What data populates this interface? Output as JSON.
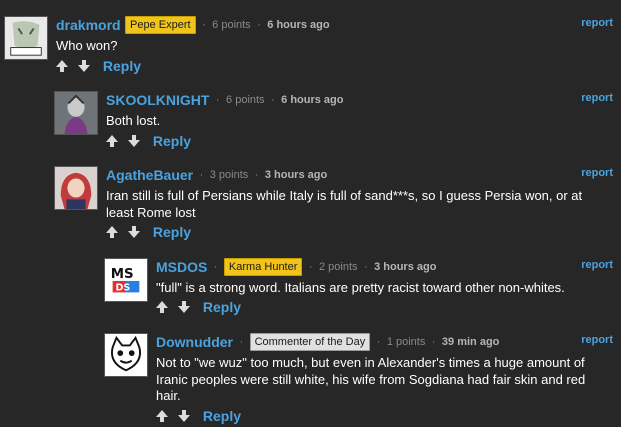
{
  "report_label": "report",
  "reply_label": "Reply",
  "separator": "·",
  "colors": {
    "background": "#272727",
    "link": "#4aa3df",
    "gold_badge": "#f0c419",
    "grey_badge": "#e0e0e0"
  },
  "comments": [
    {
      "username": "drakmord",
      "badge": "Pepe Expert",
      "points": "6 points",
      "time": "6 hours ago",
      "text": "Who won?"
    },
    {
      "username": "SKOOLKNIGHT",
      "badge": "",
      "points": "6 points",
      "time": "6 hours ago",
      "text": "Both lost."
    },
    {
      "username": "AgatheBauer",
      "badge": "",
      "points": "3 points",
      "time": "3 hours ago",
      "text": "Iran still is full of Persians while Italy is full of sand***s, so I guess Persia won, or at least Rome lost"
    },
    {
      "username": "MSDOS",
      "badge": "Karma Hunter",
      "points": "2 points",
      "time": "3 hours ago",
      "text": "\"full\" is a strong word. Italians are pretty racist toward other non-whites."
    },
    {
      "username": "Downudder",
      "badge": "Commenter of the Day",
      "points": "1 points",
      "time": "39 min ago",
      "text": "Not to \"we wuz\" too much, but even in Alexander's times a huge amount of Iranic peoples were still white, his wife from Sogdiana had fair skin and red hair."
    }
  ]
}
